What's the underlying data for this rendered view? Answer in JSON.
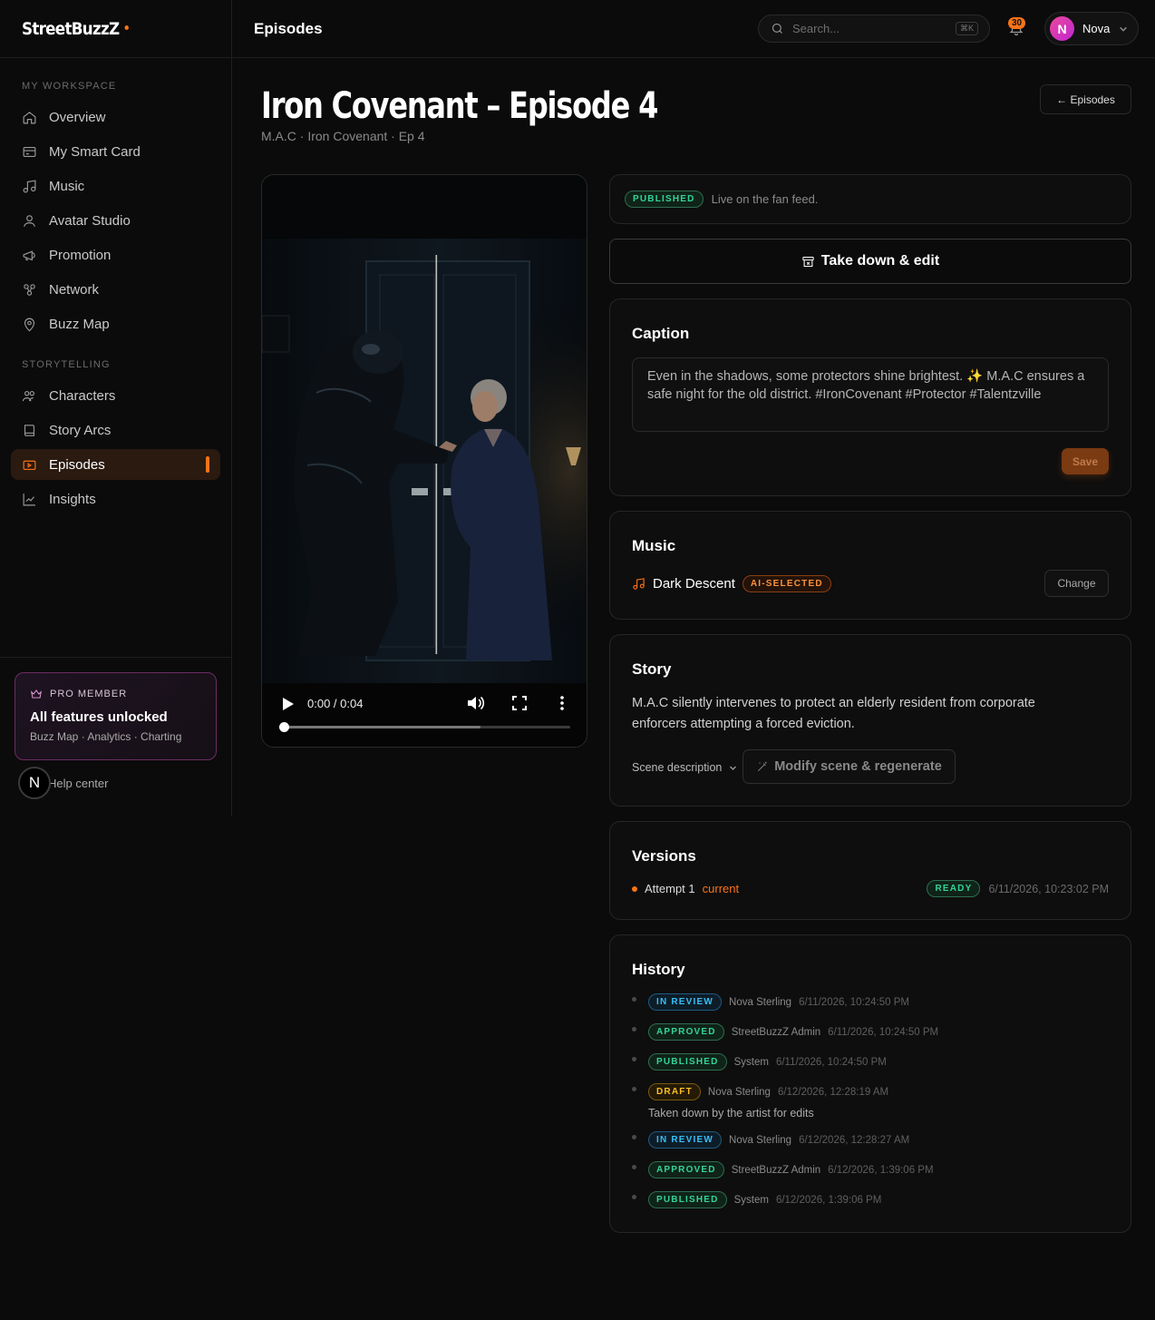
{
  "app": {
    "logo": "StreetBuzzZ",
    "page_header": "Episodes"
  },
  "sidebar": {
    "sections": [
      {
        "label": "MY WORKSPACE"
      },
      {
        "label": "STORYTELLING"
      }
    ],
    "items": [
      {
        "label": "Overview",
        "icon": "home-icon"
      },
      {
        "label": "My Smart Card",
        "icon": "card-icon"
      },
      {
        "label": "Music",
        "icon": "music-icon"
      },
      {
        "label": "Avatar Studio",
        "icon": "user-icon"
      },
      {
        "label": "Promotion",
        "icon": "megaphone-icon"
      },
      {
        "label": "Network",
        "icon": "network-icon"
      },
      {
        "label": "Buzz Map",
        "icon": "map-pin-icon"
      },
      {
        "label": "Characters",
        "icon": "people-icon"
      },
      {
        "label": "Story Arcs",
        "icon": "book-icon"
      },
      {
        "label": "Episodes",
        "icon": "video-icon",
        "active": true
      },
      {
        "label": "Insights",
        "icon": "chart-icon"
      }
    ],
    "pro": {
      "label": "PRO MEMBER",
      "title": "All features unlocked",
      "sub": "Buzz Map · Analytics · Charting"
    },
    "help": {
      "badge": "N",
      "label": "Help center"
    }
  },
  "topbar": {
    "search_placeholder": "Search...",
    "search_shortcut": "⌘K",
    "notifications": "30",
    "user": {
      "initial": "N",
      "name": "Nova"
    }
  },
  "episode": {
    "title": "Iron Covenant – Episode 4",
    "subtitle": "M.A.C · Iron Covenant · Ep 4",
    "back_label": "← Episodes"
  },
  "video": {
    "time": "0:00 / 0:04",
    "progress": 0,
    "buffered": 0.69
  },
  "status": {
    "badge": "PUBLISHED",
    "text": "Live on the fan feed."
  },
  "takedown_label": "Take down & edit",
  "caption": {
    "title": "Caption",
    "text": "Even in the shadows, some protectors shine brightest. ✨ M.A.C ensures a safe night for the old district. #IronCovenant #Protector #Talentzville",
    "save_label": "Save"
  },
  "music": {
    "title": "Music",
    "track": "Dark Descent",
    "badge": "AI-SELECTED",
    "change_label": "Change"
  },
  "story": {
    "title": "Story",
    "text": "M.A.C silently intervenes to protect an elderly resident from corporate enforcers attempting a forced eviction.",
    "scene_label": "Scene description",
    "regen_label": "Modify scene & regenerate"
  },
  "versions": {
    "title": "Versions",
    "items": [
      {
        "label": "Attempt 1",
        "current": "current",
        "status": "READY",
        "time": "6/11/2026, 10:23:02 PM"
      }
    ]
  },
  "history": {
    "title": "History",
    "items": [
      {
        "status": "IN REVIEW",
        "color": "blue",
        "by": "Nova Sterling",
        "time": "6/11/2026, 10:24:50 PM"
      },
      {
        "status": "APPROVED",
        "color": "green",
        "by": "StreetBuzzZ Admin",
        "time": "6/11/2026, 10:24:50 PM"
      },
      {
        "status": "PUBLISHED",
        "color": "green",
        "by": "System",
        "time": "6/11/2026, 10:24:50 PM"
      },
      {
        "status": "DRAFT",
        "color": "amber",
        "by": "Nova Sterling",
        "time": "6/12/2026, 12:28:19 AM",
        "note": "Taken down by the artist for edits"
      },
      {
        "status": "IN REVIEW",
        "color": "blue",
        "by": "Nova Sterling",
        "time": "6/12/2026, 12:28:27 AM"
      },
      {
        "status": "APPROVED",
        "color": "green",
        "by": "StreetBuzzZ Admin",
        "time": "6/12/2026, 1:39:06 PM"
      },
      {
        "status": "PUBLISHED",
        "color": "green",
        "by": "System",
        "time": "6/12/2026, 1:39:06 PM"
      }
    ]
  },
  "colors": {
    "accent": "#f97316",
    "background": "#0b0b0b",
    "green": "#34d399",
    "blue": "#38bdf8",
    "amber": "#fbbf24"
  }
}
